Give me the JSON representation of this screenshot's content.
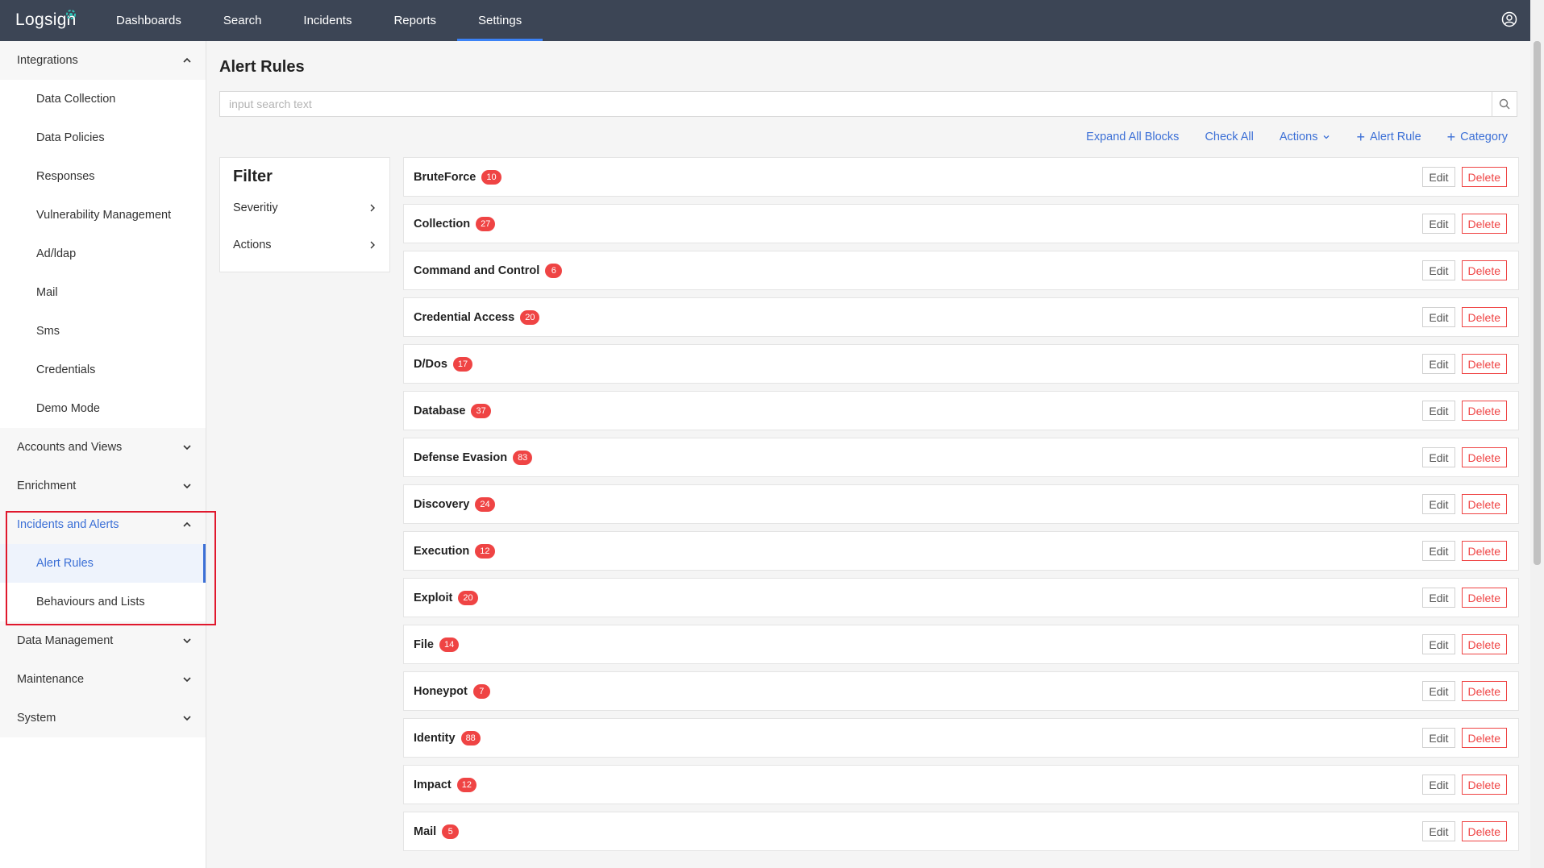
{
  "app": {
    "logo": "Logsign"
  },
  "nav": {
    "items": [
      {
        "label": "Dashboards"
      },
      {
        "label": "Search"
      },
      {
        "label": "Incidents"
      },
      {
        "label": "Reports"
      },
      {
        "label": "Settings",
        "active": true
      }
    ]
  },
  "sidebar": {
    "integrations": "Integrations",
    "integrations_items": [
      "Data Collection",
      "Data Policies",
      "Responses",
      "Vulnerability Management",
      "Ad/ldap",
      "Mail",
      "Sms",
      "Credentials",
      "Demo Mode"
    ],
    "accounts": "Accounts and Views",
    "enrichment": "Enrichment",
    "incidents": "Incidents and Alerts",
    "incidents_items": [
      "Alert Rules",
      "Behaviours and Lists"
    ],
    "data_management": "Data Management",
    "maintenance": "Maintenance",
    "system": "System"
  },
  "main": {
    "title": "Alert Rules",
    "search_placeholder": "input search text",
    "toolbar": {
      "expand": "Expand All Blocks",
      "check": "Check All",
      "actions": "Actions",
      "alert_rule": "Alert Rule",
      "category": "Category"
    },
    "filter": {
      "title": "Filter",
      "rows": [
        "Severitiy",
        "Actions"
      ]
    },
    "edit_label": "Edit",
    "delete_label": "Delete",
    "blocks": [
      {
        "name": "BruteForce",
        "count": "10"
      },
      {
        "name": "Collection",
        "count": "27"
      },
      {
        "name": "Command and Control",
        "count": "6"
      },
      {
        "name": "Credential Access",
        "count": "20"
      },
      {
        "name": "D/Dos",
        "count": "17"
      },
      {
        "name": "Database",
        "count": "37"
      },
      {
        "name": "Defense Evasion",
        "count": "83"
      },
      {
        "name": "Discovery",
        "count": "24"
      },
      {
        "name": "Execution",
        "count": "12"
      },
      {
        "name": "Exploit",
        "count": "20"
      },
      {
        "name": "File",
        "count": "14"
      },
      {
        "name": "Honeypot",
        "count": "7"
      },
      {
        "name": "Identity",
        "count": "88"
      },
      {
        "name": "Impact",
        "count": "12"
      },
      {
        "name": "Mail",
        "count": "5"
      }
    ]
  },
  "colors": {
    "topbar": "#3c4555",
    "accent": "#3b6fd6",
    "danger": "#ef4444",
    "highlight": "#e0182d"
  }
}
